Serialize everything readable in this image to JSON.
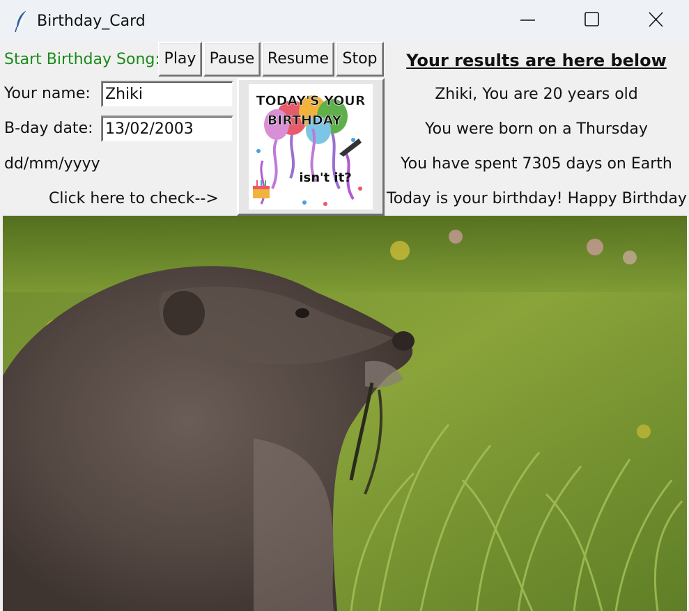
{
  "window": {
    "title": "Birthday_Card",
    "app_icon": "feather-icon",
    "controls": [
      "minimize-icon",
      "maximize-icon",
      "close-icon"
    ]
  },
  "song": {
    "label": "Start Birthday Song:",
    "label_color": "#1a8a1a",
    "buttons": {
      "play": "Play",
      "pause": "Pause",
      "resume": "Resume",
      "stop": "Stop"
    }
  },
  "form": {
    "name_label": "Your name:",
    "name_value": "Zhiki",
    "date_label": "B-day date:",
    "date_value": "13/02/2003",
    "date_format": "dd/mm/yyyy",
    "check_label": "Click here to check-->"
  },
  "card_image": {
    "line1": "TODAY'S YOUR",
    "line2": "BIRTHDAY",
    "line3": "isn't it?"
  },
  "results": {
    "title": "Your results are here below",
    "age": "Zhiki, You are 20 years old",
    "weekday": "You were born on a Thursday",
    "days": "You have spent 7305 days on Earth",
    "message": "Today is your birthday! Happy Birthday!"
  },
  "photo": {
    "subject": "marmot-in-grass-photo"
  }
}
